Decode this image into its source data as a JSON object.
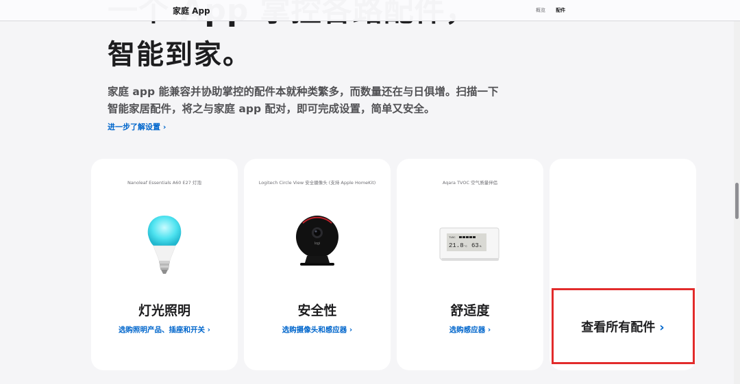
{
  "nav": {
    "title": "家庭 App",
    "links": [
      "概览",
      "配件"
    ]
  },
  "hero": {
    "line1": "一个 App 掌控各路配件，",
    "line2": "智能到家。",
    "body": "家庭 app 能兼容并协助掌控的配件本就种类繁多，而数量还在与日俱增。扫描一下智能家居配件，将之与家庭 app 配对，即可完成设置，简单又安全。",
    "learn_more": "进一步了解设置 ›"
  },
  "cards": [
    {
      "product": "Nanoleaf Essentials A60 E27 灯泡",
      "title": "灯光照明",
      "link": "选购照明产品、插座和开关 ›",
      "icon": "light-bulb-icon"
    },
    {
      "product": "Logitech Circle View 安全摄像头 (支持 Apple HomeKit)",
      "title": "安全性",
      "link": "选购摄像头和感应器 ›",
      "icon": "security-camera-icon"
    },
    {
      "product": "Aqara TVOC 空气质量伴侣",
      "title": "舒适度",
      "link": "选购感应器 ›",
      "icon": "air-quality-sensor-icon"
    }
  ],
  "sensor_display": {
    "label": "TVOC",
    "temperature": "21.8",
    "temperature_unit": "°C",
    "humidity": "63",
    "humidity_unit": "%"
  },
  "camera_brand": "logi",
  "view_all": {
    "label": "查看所有配件",
    "chevron": "›"
  },
  "colors": {
    "link": "#0066cc",
    "highlight": "#e22b2b",
    "background": "#f5f5f7"
  }
}
